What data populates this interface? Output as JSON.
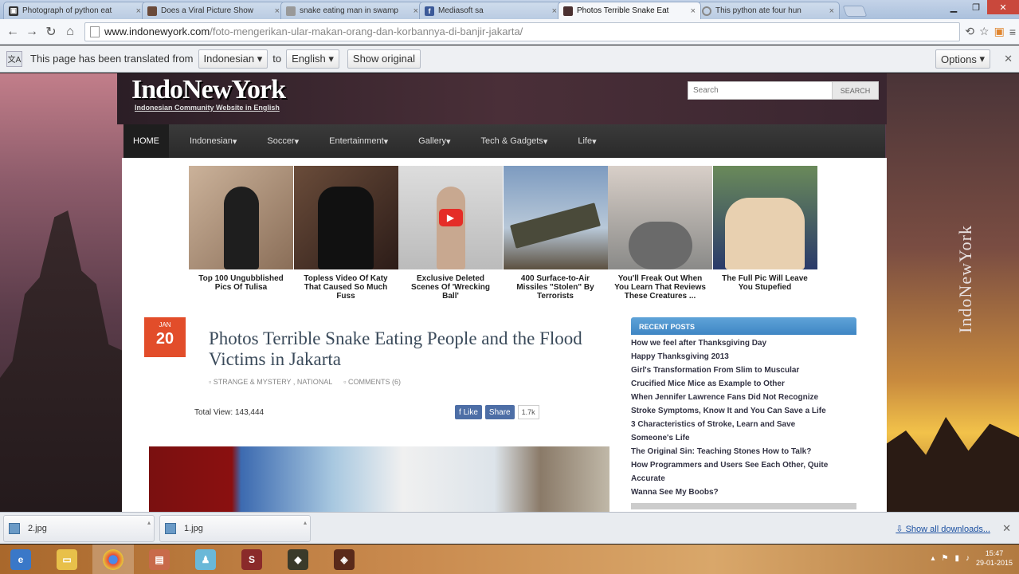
{
  "tabs": [
    {
      "title": "Photograph of python eat",
      "favicon": "image-icon"
    },
    {
      "title": "Does a Viral Picture Show",
      "favicon": "page-icon"
    },
    {
      "title": "snake eating man in swamp",
      "favicon": "page-icon"
    },
    {
      "title": "Mediasoft sa",
      "favicon": "facebook-icon"
    },
    {
      "title": "Photos Terrible Snake Eat",
      "favicon": "page-icon",
      "active": true
    },
    {
      "title": "This python ate four hun",
      "favicon": "loading-icon"
    }
  ],
  "address": {
    "host": "www.indonewyork.com",
    "path": "/foto-mengerikan-ular-makan-orang-dan-korbannya-di-banjir-jakarta/"
  },
  "translate": {
    "text_from": "This page has been translated from",
    "source": "Indonesian",
    "to": "to",
    "target": "English",
    "show_original": "Show original",
    "options": "Options"
  },
  "site": {
    "logo": "IndoNewYork",
    "tagline": "Indonesian Community Website in English",
    "search_placeholder": "Search",
    "search_button": "SEARCH",
    "side_logo": "IndoNewYork",
    "nav": [
      "HOME",
      "Indonesian",
      "Soccer",
      "Entertainment",
      "Gallery",
      "Tech & Gadgets",
      "Life"
    ]
  },
  "thumbs": [
    {
      "caption": "Top 100 Ungubblished Pics Of Tulisa"
    },
    {
      "caption": "Topless Video Of Katy That Caused So Much Fuss"
    },
    {
      "caption": "Exclusive Deleted Scenes Of 'Wrecking Ball'"
    },
    {
      "caption": "400 Surface-to-Air Missiles \"Stolen\" By Terrorists"
    },
    {
      "caption": "You'll Freak Out When You Learn That Reviews These Creatures ..."
    },
    {
      "caption": "The Full Pic Will Leave You Stupefied"
    }
  ],
  "article": {
    "month": "JAN",
    "day": "20",
    "title": "Photos Terrible Snake Eating People and the Flood Victims in Jakarta",
    "categories": "STRANGE & MYSTERY , NATIONAL",
    "comments": "COMMENTS (6)",
    "total_views": "Total View: 143,444",
    "like": "Like",
    "share": "Share",
    "count": "1.7k"
  },
  "sidebar": {
    "heading": "RECENT POSTS",
    "posts": [
      "How we feel after Thanksgiving Day",
      "Happy Thanksgiving 2013",
      "Girl's Transformation From Slim to Muscular",
      "Crucified Mice Mice as Example to Other",
      "When Jennifer Lawrence Fans Did Not Recognize",
      "Stroke Symptoms, Know It and You Can Save a Life",
      "3 Characteristics of Stroke, Learn and Save",
      "Someone's Life",
      "The Original Sin: Teaching Stones How to Talk?",
      "How Programmers and Users See Each Other, Quite",
      "Accurate",
      "Wanna See My Boobs?"
    ]
  },
  "downloads": {
    "items": [
      "2.jpg",
      "1.jpg"
    ],
    "show_all": "Show all downloads..."
  },
  "taskbar": {
    "time": "15:47",
    "date": "29-01-2015"
  },
  "colors": {
    "date_box": "#e24d2a",
    "sidebar_head": "#3f86c4",
    "facebook": "#4d6ea6"
  }
}
